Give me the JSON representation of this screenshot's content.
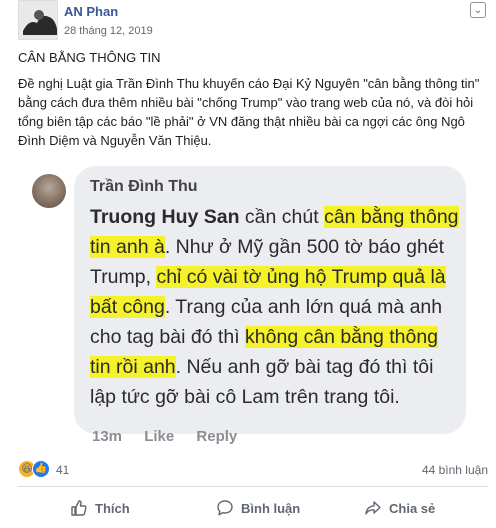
{
  "post": {
    "author": "AN Phan",
    "date": "28 tháng 12, 2019",
    "title": "CÂN BẰNG THÔNG TIN",
    "body": "Đề nghị Luật gia Trần Đình Thu khuyến cáo Đại Kỷ Nguyên \"cân bằng thông tin\" bằng cách đưa thêm nhiều bài \"chống Trump\" vào trang web của nó, và đòi hỏi tổng biên tập các báo \"lề phải\" ở VN đăng thật nhiều bài ca ngợi các ông Ngô Đình Diệm và Nguyễn Văn Thiệu."
  },
  "screenshot": {
    "commenter": "Trần Đình Thu",
    "tag": "Truong Huy San",
    "t1": " cần chút ",
    "h1": "cân bằng thông tin anh à",
    "t2": ". Như ở Mỹ gần 500 tờ báo ghét Trump, ",
    "h2": "chỉ có vài tờ ủng hộ Trump quả là bất công",
    "t3": ". Trang của anh lớn quá mà anh cho tag bài đó thì ",
    "h3": "không cân bằng thông tin rồi anh",
    "t4": ". Nếu anh gỡ bài tag đó thì tôi lập tức gỡ bài cô Lam trên trang tôi.",
    "time": "13m",
    "like": "Like",
    "reply": "Reply"
  },
  "stats": {
    "reactions": "41",
    "comments": "44 bình luận"
  },
  "actions": {
    "like": "Thích",
    "comment": "Bình luận",
    "share": "Chia sẻ"
  },
  "colors": {
    "highlight": "#f5f12a",
    "link": "#385898"
  }
}
